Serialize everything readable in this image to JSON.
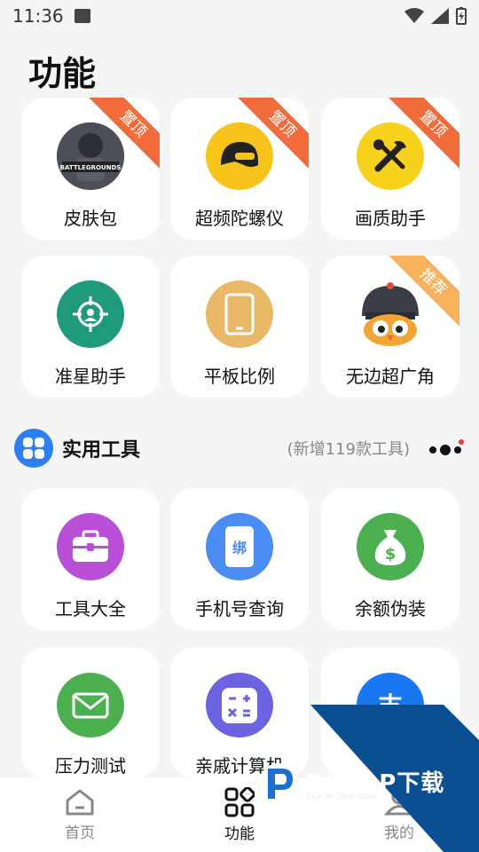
{
  "status_bar": {
    "time": "11:36"
  },
  "page_title": "功能",
  "features": [
    {
      "label": "皮肤包",
      "badge": "置顶",
      "icon": "pubg-logo-icon",
      "icon_text": "BATTLEGROUNDS"
    },
    {
      "label": "超频陀螺仪",
      "badge": "置顶",
      "icon": "helmet-icon"
    },
    {
      "label": "画质助手",
      "badge": "置顶",
      "icon": "tools-icon"
    },
    {
      "label": "准星助手",
      "badge": "",
      "icon": "crosshair-icon"
    },
    {
      "label": "平板比例",
      "badge": "",
      "icon": "tablet-icon"
    },
    {
      "label": "无边超广角",
      "badge": "推荐",
      "icon": "bird-helmet-icon"
    }
  ],
  "tools_section": {
    "title": "实用工具",
    "count_text": "(新增119款工具)"
  },
  "tools": [
    {
      "label": "工具大全",
      "icon": "toolbox-icon",
      "color": "#b84fd6"
    },
    {
      "label": "手机号查询",
      "icon": "phone-bind-icon",
      "color": "#4a8cf2",
      "icon_text": "绑"
    },
    {
      "label": "余额伪装",
      "icon": "money-bag-icon",
      "color": "#4caf50",
      "icon_text": "$"
    },
    {
      "label": "压力测试",
      "icon": "mail-icon",
      "color": "#4caf50"
    },
    {
      "label": "亲戚计算机",
      "icon": "calculator-icon",
      "color": "#6b63e0"
    },
    {
      "label": "支",
      "icon": "alipay-icon",
      "color": "#1a77f2",
      "icon_text": "支"
    }
  ],
  "bottom_nav": [
    {
      "label": "首页",
      "icon": "home-icon"
    },
    {
      "label": "功能",
      "icon": "grid-icon"
    },
    {
      "label": "我的",
      "icon": "profile-icon"
    }
  ],
  "watermark": {
    "brand": "PCPOP下载",
    "sub": "PCPOP Download"
  },
  "colors": {
    "accent": "#2f7ff0",
    "badge_top": "#f26b3a",
    "badge_rec": "#f7b25b",
    "watermark": "#0b4f93"
  }
}
